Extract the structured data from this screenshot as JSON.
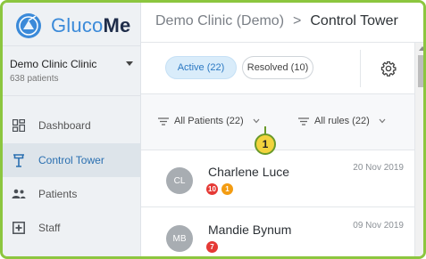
{
  "app": {
    "name_part1": "Gluco",
    "name_part2": "Me"
  },
  "clinic": {
    "name": "Demo Clinic Clinic",
    "patients": "638 patients"
  },
  "nav": [
    {
      "label": "Dashboard",
      "icon": "dashboard-icon",
      "active": false
    },
    {
      "label": "Control Tower",
      "icon": "tower-icon",
      "active": true
    },
    {
      "label": "Patients",
      "icon": "patients-icon",
      "active": false
    },
    {
      "label": "Staff",
      "icon": "staff-icon",
      "active": false
    }
  ],
  "breadcrumb": {
    "clinic": "Demo Clinic (Demo)",
    "separator": ">",
    "page": "Control Tower"
  },
  "tabs": {
    "active": "Active (22)",
    "resolved": "Resolved (10)"
  },
  "filters": {
    "patients": "All Patients (22)",
    "rules": "All rules (22)"
  },
  "marker": {
    "label": "1"
  },
  "patients": [
    {
      "initials": "CL",
      "name": "Charlene Luce",
      "date": "20 Nov 2019",
      "badges": [
        {
          "value": "10",
          "color": "#e53935"
        },
        {
          "value": "1",
          "color": "#f39c12"
        }
      ]
    },
    {
      "initials": "MB",
      "name": "Mandie Bynum",
      "date": "09 Nov 2019",
      "badges": [
        {
          "value": "7",
          "color": "#e53935"
        }
      ]
    }
  ],
  "colors": {
    "accent": "#2b78c2",
    "frame": "#8cc63f",
    "badge_red": "#e53935",
    "badge_orange": "#f39c12"
  }
}
